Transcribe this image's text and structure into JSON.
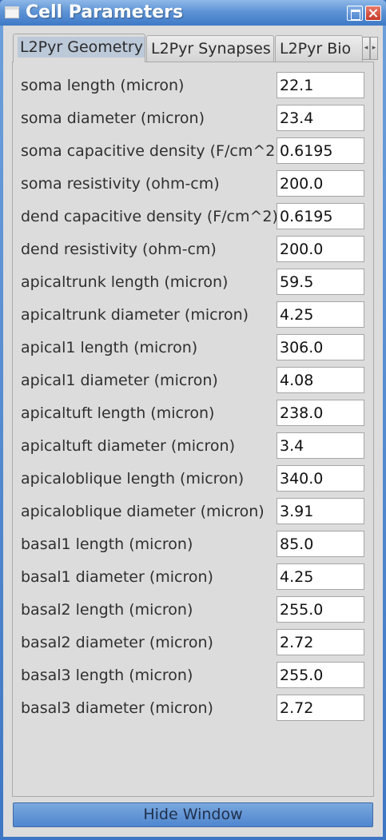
{
  "window": {
    "title": "Cell Parameters"
  },
  "tabs": [
    {
      "label": "L2Pyr Geometry",
      "active": true
    },
    {
      "label": "L2Pyr Synapses",
      "active": false
    },
    {
      "label": "L2Pyr Bio",
      "active": false
    }
  ],
  "tab_scroll": {
    "left_glyph": "◂",
    "right_glyph": "▸"
  },
  "params": [
    {
      "label": "soma length (micron)",
      "value": "22.1"
    },
    {
      "label": "soma diameter (micron)",
      "value": "23.4"
    },
    {
      "label": "soma capacitive density (F/cm^2)",
      "value": "0.6195"
    },
    {
      "label": "soma resistivity (ohm-cm)",
      "value": "200.0"
    },
    {
      "label": "dend capacitive density (F/cm^2)",
      "value": "0.6195"
    },
    {
      "label": "dend resistivity (ohm-cm)",
      "value": "200.0"
    },
    {
      "label": "apicaltrunk length (micron)",
      "value": "59.5"
    },
    {
      "label": "apicaltrunk diameter (micron)",
      "value": "4.25"
    },
    {
      "label": "apical1 length (micron)",
      "value": "306.0"
    },
    {
      "label": "apical1 diameter (micron)",
      "value": "4.08"
    },
    {
      "label": "apicaltuft length (micron)",
      "value": "238.0"
    },
    {
      "label": "apicaltuft diameter (micron)",
      "value": "3.4"
    },
    {
      "label": "apicaloblique length (micron)",
      "value": "340.0"
    },
    {
      "label": "apicaloblique diameter (micron)",
      "value": "3.91"
    },
    {
      "label": "basal1 length (micron)",
      "value": "85.0"
    },
    {
      "label": "basal1 diameter (micron)",
      "value": "4.25"
    },
    {
      "label": "basal2 length (micron)",
      "value": "255.0"
    },
    {
      "label": "basal2 diameter (micron)",
      "value": "2.72"
    },
    {
      "label": "basal3 length (micron)",
      "value": "255.0"
    },
    {
      "label": "basal3 diameter (micron)",
      "value": "2.72"
    }
  ],
  "footer": {
    "hide_label": "Hide Window"
  },
  "colors": {
    "titlebar": "#5e94d6",
    "client_bg": "#dcdcdc",
    "active_tab_highlight": "#bcc9d9",
    "button": "#6a9bd8"
  }
}
